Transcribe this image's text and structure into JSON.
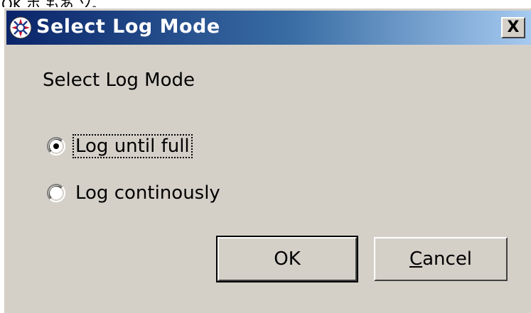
{
  "top_strip_text": "OK ポ もあ.ソ。",
  "window": {
    "title": "Select Log Mode",
    "close_label": "X"
  },
  "dialog": {
    "prompt": "Select Log Mode",
    "options": [
      {
        "label": "Log until full",
        "selected": true
      },
      {
        "label": "Log continously",
        "selected": false
      }
    ],
    "ok_label": "OK",
    "cancel_mnemonic": "C",
    "cancel_rest": "ancel"
  },
  "colors": {
    "face": "#d4d0c8",
    "title_start": "#0a246a",
    "title_end": "#a6caf0"
  },
  "icons": {
    "app": "settings-app-icon",
    "close": "close-icon"
  }
}
